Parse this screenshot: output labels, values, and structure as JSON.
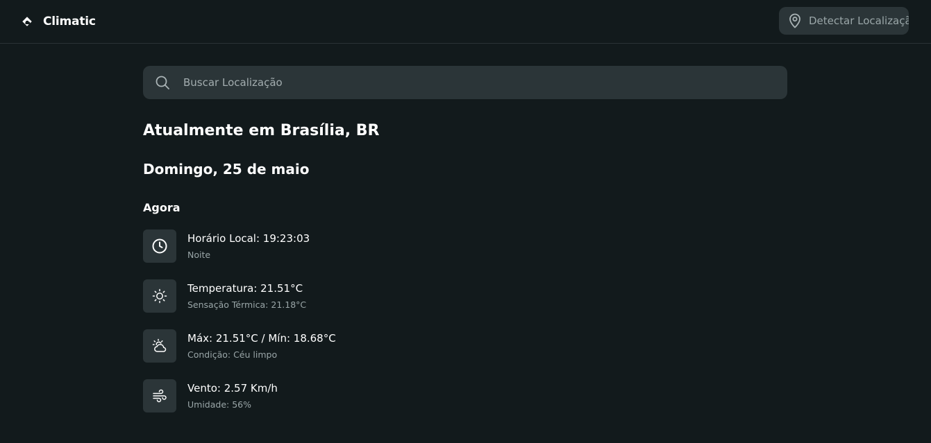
{
  "app": {
    "name": "Climatic",
    "logo_icon": "cloud-sun-logo-icon"
  },
  "header": {
    "detect_location_label": "Detectar Localização",
    "detect_location_icon": "map-pin-icon"
  },
  "search": {
    "placeholder": "Buscar Localização",
    "value": "",
    "icon": "search-icon"
  },
  "main": {
    "title": "Atualmente em Brasília, BR",
    "date": "Domingo, 25 de maio",
    "section_title": "Agora",
    "items": [
      {
        "icon": "clock-icon",
        "primary": "Horário Local: 19:23:03",
        "secondary": "Noite"
      },
      {
        "icon": "sun-icon",
        "primary": "Temperatura: 21.51°C",
        "secondary": "Sensação Térmica: 21.18°C"
      },
      {
        "icon": "cloud-sun-icon",
        "primary": "Máx: 21.51°C / Mín: 18.68°C",
        "secondary": "Condição: Céu limpo"
      },
      {
        "icon": "wind-icon",
        "primary": "Vento: 2.57 Km/h",
        "secondary": "Umidade: 56%"
      }
    ]
  },
  "colors": {
    "background": "#121a1c",
    "surface": "#2b3538",
    "divider": "#2a3336",
    "text_primary": "#ffffff",
    "text_secondary": "#9aa6a8"
  }
}
